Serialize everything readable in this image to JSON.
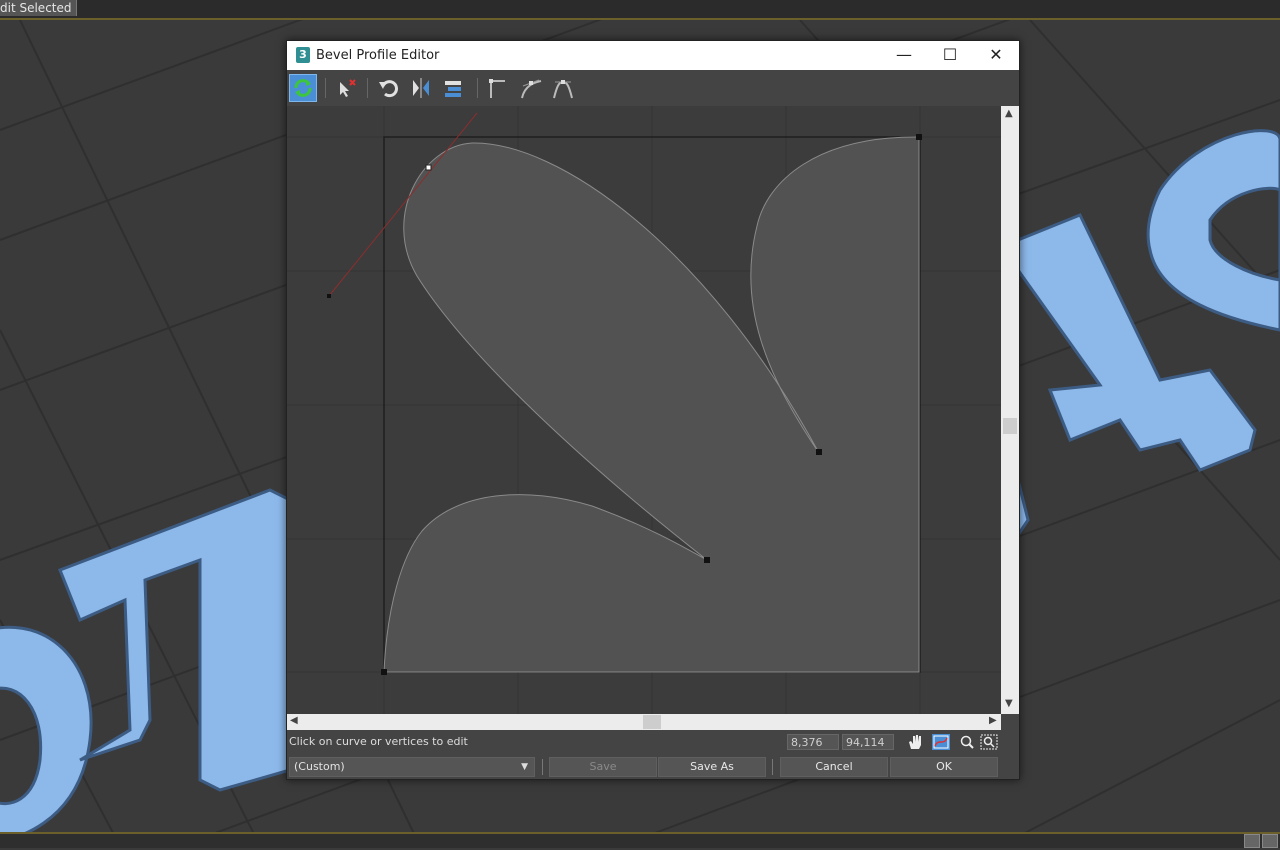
{
  "topbar": {
    "label": "dit Selected"
  },
  "window": {
    "app_icon": "3",
    "title": "Bevel Profile Editor",
    "controls": {
      "minimize": "—",
      "maximize": "☐",
      "close": "✕"
    }
  },
  "toolbar": {
    "icons": [
      "refresh-icon",
      "delete-point-icon",
      "undo-icon",
      "mirror-icon",
      "align-icon",
      "corner-point-icon",
      "bezier-smooth-icon",
      "bezier-corner-icon"
    ]
  },
  "status": {
    "hint": "Click on curve or vertices to edit",
    "coord_x": "8,376",
    "coord_y": "94,114"
  },
  "buttons": {
    "preset_value": "(Custom)",
    "save": "Save",
    "save_as": "Save As",
    "cancel": "Cancel",
    "ok": "OK"
  },
  "colors": {
    "viewport_bg": "#3a3a3a",
    "text_model": "#8cb8ea",
    "profile_fill": "#525252",
    "active_tool": "#4a8fd6"
  }
}
